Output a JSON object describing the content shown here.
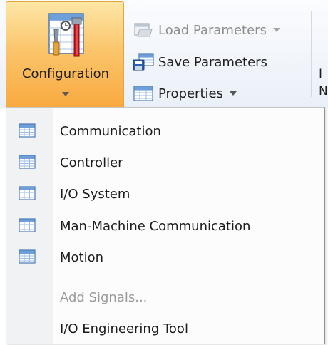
{
  "ribbon": {
    "configuration": {
      "label": "Configuration",
      "icon": "configuration-tools-icon"
    },
    "buttons": [
      {
        "label": "Load Parameters",
        "icon": "load-parameters-icon",
        "enabled": false,
        "has_dropdown": true
      },
      {
        "label": "Save Parameters",
        "icon": "save-parameters-icon",
        "enabled": true,
        "has_dropdown": false
      },
      {
        "label": "Properties",
        "icon": "properties-icon",
        "enabled": true,
        "has_dropdown": true
      }
    ],
    "cut_text": [
      "I",
      "N"
    ]
  },
  "menu": {
    "items": [
      {
        "label": "Communication",
        "icon": "table-icon"
      },
      {
        "label": "Controller",
        "icon": "table-icon"
      },
      {
        "label": "I/O System",
        "icon": "table-icon"
      },
      {
        "label": "Man-Machine Communication",
        "icon": "table-icon"
      },
      {
        "label": "Motion",
        "icon": "table-icon"
      }
    ],
    "actions": [
      {
        "label": "Add Signals...",
        "enabled": false
      },
      {
        "label": "I/O Engineering Tool",
        "enabled": true
      }
    ]
  },
  "colors": {
    "active_button_top": "#fde6a6",
    "active_button_bottom": "#f9a93f",
    "disabled_text": "#9a9a9a",
    "ribbon_background": "#eaf0f8"
  }
}
